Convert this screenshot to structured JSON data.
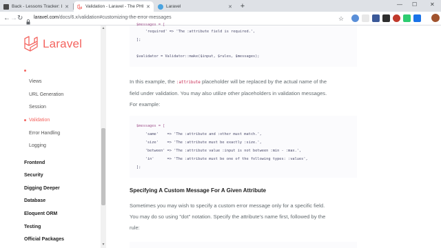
{
  "browser": {
    "tabs": [
      {
        "title": "Back - Lessons Tracker: Laravel 8",
        "active": false
      },
      {
        "title": "Validation - Laravel - The PHP Fra",
        "active": true
      },
      {
        "title": "Laravel",
        "active": false
      }
    ],
    "new_tab": "+",
    "window": {
      "minimize": "—",
      "maximize": "☐",
      "close": "✕"
    },
    "url_host": "laravel.com",
    "url_path": "/docs/6.x/validation#customizing-the-error-messages",
    "back": "←",
    "forward": "→",
    "reload": "↻",
    "star": "☆",
    "menu": "⋮"
  },
  "sidebar": {
    "brand": "Laravel",
    "items": [
      {
        "label": "Views",
        "type": "sub"
      },
      {
        "label": "URL Generation",
        "type": "sub"
      },
      {
        "label": "Session",
        "type": "sub"
      },
      {
        "label": "Validation",
        "type": "sub",
        "active": true
      },
      {
        "label": "Error Handling",
        "type": "sub"
      },
      {
        "label": "Logging",
        "type": "sub"
      },
      {
        "label": "Frontend",
        "type": "section"
      },
      {
        "label": "Security",
        "type": "section"
      },
      {
        "label": "Digging Deeper",
        "type": "section"
      },
      {
        "label": "Database",
        "type": "section"
      },
      {
        "label": "Eloquent ORM",
        "type": "section"
      },
      {
        "label": "Testing",
        "type": "section"
      },
      {
        "label": "Official Packages",
        "type": "section"
      }
    ]
  },
  "content": {
    "code1": [
      "$messages = [",
      "    'required' => 'The :attribute field is required.',",
      "];",
      "",
      "$validator = Validator::make($input, $rules, $messages);"
    ],
    "para1_a": "In this example, the ",
    "para1_code": ":attribute",
    "para1_b": " placeholder will be replaced by the actual name of the",
    "para1_line2": "field under validation. You may also utilize other placeholders in validation messages.",
    "para1_line3": "For example:",
    "code2": [
      "$messages = [",
      "    'same'    => 'The :attribute and :other must match.',",
      "    'size'    => 'The :attribute must be exactly :size.',",
      "    'between' => 'The :attribute value :input is not between :min - :max.',",
      "    'in'      => 'The :attribute must be one of the following types: :values',",
      "];"
    ],
    "heading": "Specifying A Custom Message For A Given Attribute",
    "para2_line1": "Sometimes you may wish to specify a custom error message only for a specific field.",
    "para2_line2": "You may do so using \"dot\" notation. Specify the attribute's name first, followed by the",
    "para2_line3": "rule:"
  },
  "colors": {
    "accent": "#f4645f",
    "text": "#636b6f",
    "code_bg": "#fbfbfd"
  }
}
